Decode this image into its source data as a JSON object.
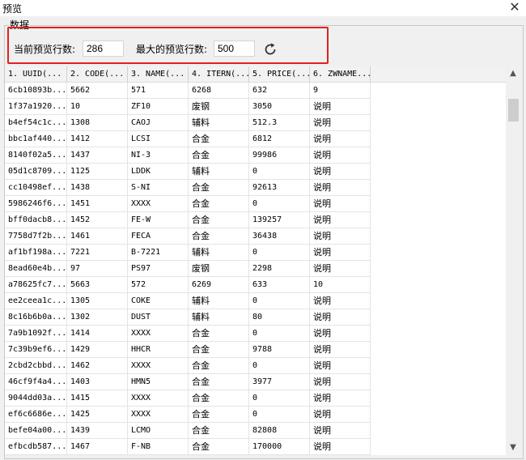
{
  "window": {
    "title": "预览",
    "close_glyph": "✕"
  },
  "group": {
    "label": "数据"
  },
  "controls": {
    "current_label": "当前预览行数:",
    "current_value": "286",
    "max_label": "最大的预览行数:",
    "max_value": "500",
    "refresh_icon": "refresh-icon"
  },
  "table": {
    "headers": [
      "1. UUID(...",
      "2. CODE(...",
      "3. NAME(...",
      "4. ITERN(...",
      "5. PRICE(...",
      "6. ZWNAME..."
    ],
    "rows": [
      [
        "6cb10893b...",
        "5662",
        "571",
        "6268",
        "632",
        "9"
      ],
      [
        "1f37a1920...",
        "10",
        "ZF10",
        "废钢",
        "3050",
        "说明"
      ],
      [
        "b4ef54c1c...",
        "1308",
        "CAOJ",
        "辅料",
        "512.3",
        "说明"
      ],
      [
        "bbc1af440...",
        "1412",
        "LCSI",
        "合金",
        "6812",
        "说明"
      ],
      [
        "8140f02a5...",
        "1437",
        "NI-3",
        "合金",
        "99986",
        "说明"
      ],
      [
        "05d1c8709...",
        "1125",
        "LDDK",
        "辅料",
        "0",
        "说明"
      ],
      [
        "cc10498ef...",
        "1438",
        "S-NI",
        "合金",
        "92613",
        "说明"
      ],
      [
        "5986246f6...",
        "1451",
        "XXXX",
        "合金",
        "0",
        "说明"
      ],
      [
        "bff0dacb8...",
        "1452",
        "FE-W",
        "合金",
        "139257",
        "说明"
      ],
      [
        "7758d7f2b...",
        "1461",
        "FECA",
        "合金",
        "36438",
        "说明"
      ],
      [
        "af1bf198a...",
        "7221",
        "B-7221",
        "辅料",
        "0",
        "说明"
      ],
      [
        "8ead60e4b...",
        "97",
        "PS97",
        "废钢",
        "2298",
        "说明"
      ],
      [
        "a78625fc7...",
        "5663",
        "572",
        "6269",
        "633",
        "10"
      ],
      [
        "ee2ceea1c...",
        "1305",
        "COKE",
        "辅料",
        "0",
        "说明"
      ],
      [
        "8c16b6b0a...",
        "1302",
        "DUST",
        "辅料",
        "80",
        "说明"
      ],
      [
        "7a9b1092f...",
        "1414",
        "XXXX",
        "合金",
        "0",
        "说明"
      ],
      [
        "7c39b9ef6...",
        "1429",
        "HHCR",
        "合金",
        "9788",
        "说明"
      ],
      [
        "2cbd2cbbd...",
        "1462",
        "XXXX",
        "合金",
        "0",
        "说明"
      ],
      [
        "46cf9f4a4...",
        "1403",
        "HMN5",
        "合金",
        "3977",
        "说明"
      ],
      [
        "9044dd03a...",
        "1415",
        "XXXX",
        "合金",
        "0",
        "说明"
      ],
      [
        "ef6c6686e...",
        "1425",
        "XXXX",
        "合金",
        "0",
        "说明"
      ],
      [
        "befe04a00...",
        "1439",
        "LCMO",
        "合金",
        "82808",
        "说明"
      ],
      [
        "efbcdb587...",
        "1467",
        "F-NB",
        "合金",
        "170000",
        "说明"
      ]
    ]
  },
  "scrollbar": {
    "up_glyph": "▲",
    "down_glyph": "▼"
  },
  "colors": {
    "highlight_box": "#e02020",
    "header_bg": "#f2f2f2"
  }
}
